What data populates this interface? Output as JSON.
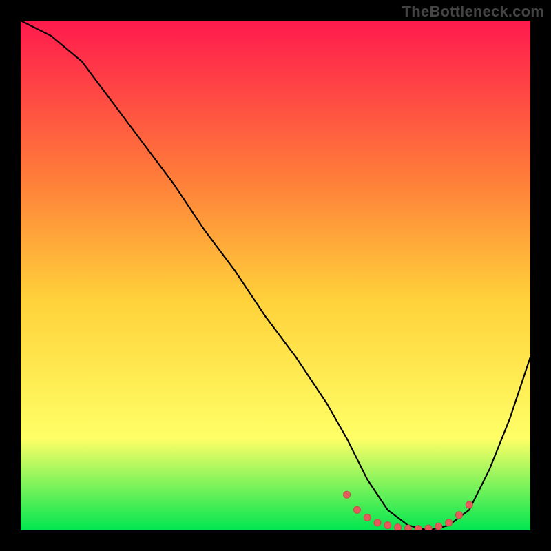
{
  "watermark": "TheBottleneck.com",
  "accent": {
    "marker_fill": "#e55a5a",
    "marker_stroke": "#cc4b4b",
    "curve_stroke": "#000000"
  },
  "chart_data": {
    "type": "line",
    "title": "",
    "xlabel": "",
    "ylabel": "",
    "xlim": [
      0,
      100
    ],
    "ylim": [
      0,
      100
    ],
    "grid": false,
    "legend": false,
    "background_gradient": {
      "top": "#ff1a4d",
      "mid_upper": "#ff7a3a",
      "mid": "#ffd23a",
      "mid_lower": "#ffff66",
      "bottom": "#00e650"
    },
    "series": [
      {
        "name": "bottleneck-curve",
        "x": [
          0,
          6,
          12,
          18,
          24,
          30,
          36,
          42,
          48,
          54,
          60,
          64,
          68,
          72,
          76,
          80,
          84,
          88,
          92,
          96,
          100
        ],
        "values": [
          100,
          97,
          92,
          84,
          76,
          68,
          59,
          51,
          42,
          34,
          25,
          18,
          10,
          4,
          1,
          0,
          1,
          4,
          12,
          22,
          34
        ]
      }
    ],
    "optimal_markers": {
      "comment": "dotted coral markers along the valley floor",
      "x": [
        64,
        66,
        68,
        70,
        72,
        74,
        76,
        78,
        80,
        82,
        84,
        86,
        88
      ],
      "values": [
        7,
        4,
        2.5,
        1.5,
        1,
        0.6,
        0.4,
        0.3,
        0.4,
        0.8,
        1.5,
        3,
        5
      ]
    }
  }
}
